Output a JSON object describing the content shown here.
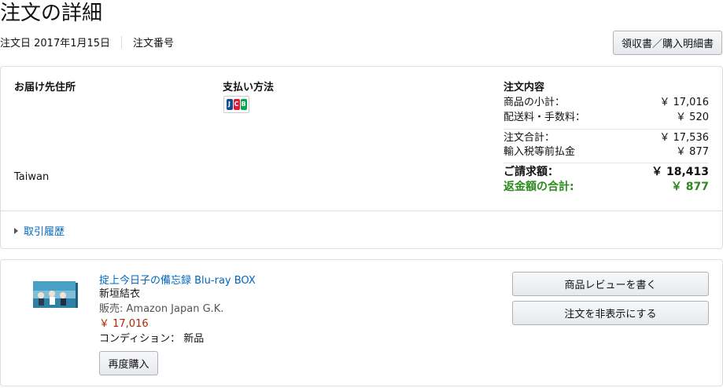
{
  "page": {
    "title": "注文の詳細",
    "order_date": "注文日 2017年1月15日",
    "order_number_label": "注文番号",
    "invoice_button": "領収書／購入明細書"
  },
  "summary": {
    "address_heading": "お届け先住所",
    "address_country": "Taiwan",
    "payment_heading": "支払い方法",
    "payment_card": "JCB",
    "order_heading": "注文内容",
    "rows": [
      {
        "label": "商品の小計：",
        "value": "￥ 17,016"
      },
      {
        "label": "配送料・手数料：",
        "value": "￥ 520"
      },
      {
        "label": "注文合計：",
        "value": "￥ 17,536"
      },
      {
        "label": "輸入税等前払金",
        "value": "￥ 877"
      },
      {
        "label": "ご請求額：",
        "value": "￥ 18,413"
      },
      {
        "label": "返金額の合計:",
        "value": "￥ 877"
      }
    ],
    "history_link": "取引履歴"
  },
  "item": {
    "title": "掟上今日子の備忘録 Blu-ray BOX",
    "author": "新垣結衣",
    "seller": "販売: Amazon Japan G.K.",
    "price": "￥ 17,016",
    "condition": "コンディション： 新品",
    "rebuy_button": "再度購入",
    "review_button": "商品レビューを書く",
    "hide_button": "注文を非表示にする"
  },
  "colors": {
    "link": "#0066c0",
    "price": "#b12704",
    "refund": "#2b8a1e"
  }
}
